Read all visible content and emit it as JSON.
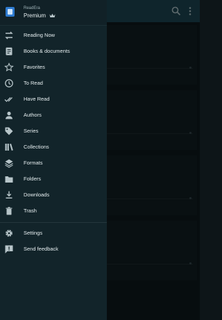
{
  "drawer": {
    "app_name": "ReadEra",
    "plan": "Premium",
    "main_items": [
      {
        "label": "Reading Now",
        "icon": "swap-icon"
      },
      {
        "label": "Books & documents",
        "icon": "book-icon"
      },
      {
        "label": "Favorites",
        "icon": "star-icon"
      },
      {
        "label": "To Read",
        "icon": "clock-icon"
      },
      {
        "label": "Have Read",
        "icon": "double-check-icon"
      },
      {
        "label": "Authors",
        "icon": "person-icon"
      },
      {
        "label": "Series",
        "icon": "tag-icon"
      },
      {
        "label": "Collections",
        "icon": "shelf-icon"
      },
      {
        "label": "Formats",
        "icon": "layers-icon"
      },
      {
        "label": "Folders",
        "icon": "folder-icon"
      },
      {
        "label": "Downloads",
        "icon": "download-icon"
      },
      {
        "label": "Trash",
        "icon": "trash-icon"
      }
    ],
    "secondary_items": [
      {
        "label": "Settings",
        "icon": "gear-icon"
      },
      {
        "label": "Send feedback",
        "icon": "feedback-icon"
      }
    ]
  },
  "colors": {
    "drawer_bg": "#12242a",
    "app_bar": "#173a44",
    "text": "#e6eef0",
    "icon": "#b7c5c9",
    "logo": "#2e7bd0"
  }
}
